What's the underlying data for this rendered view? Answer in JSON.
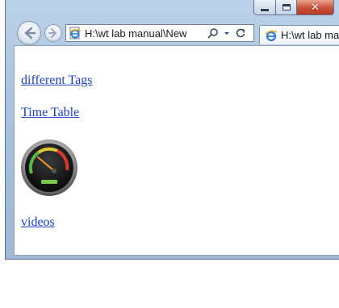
{
  "browser": {
    "address_url": "H:\\wt lab manual\\New",
    "tab_title": "H:\\wt lab manual"
  },
  "page": {
    "links": {
      "different_tags": "different Tags",
      "time_table": "Time Table",
      "videos": "videos"
    },
    "image_icon": "speedometer-gauge"
  },
  "colors": {
    "link": "#1a3ec4",
    "frame": "#a9c2de",
    "close_button": "#c9503a"
  }
}
